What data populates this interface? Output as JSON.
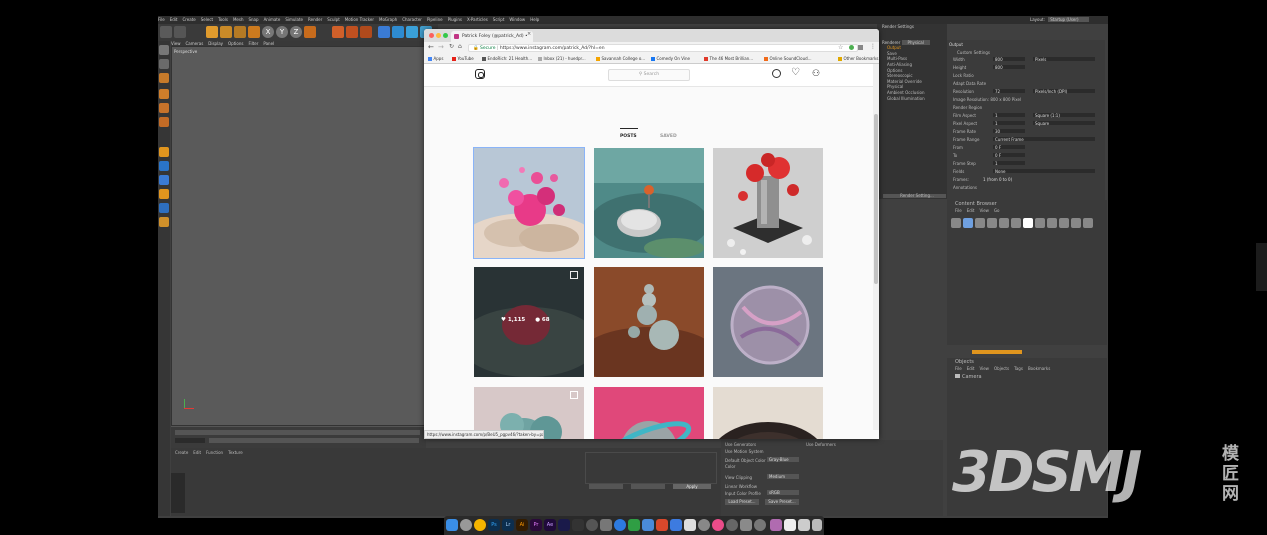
{
  "c4d": {
    "menu": [
      "File",
      "Edit",
      "Create",
      "Select",
      "Tools",
      "Mesh",
      "Snap",
      "Animate",
      "Simulate",
      "Render",
      "Sculpt",
      "Motion Tracker",
      "MoGraph",
      "Character",
      "Pipeline",
      "Plugins",
      "X-Particles",
      "Script",
      "Window",
      "Help"
    ],
    "layout_label": "Layout:",
    "layout_value": "Startup (User)",
    "viewport_menu": [
      "View",
      "Cameras",
      "Display",
      "Options",
      "Filter",
      "Panel"
    ],
    "viewport_name": "Perspective",
    "material_menu": [
      "Create",
      "Edit",
      "Function",
      "Texture"
    ],
    "apply_label": "Apply",
    "render_settings_title": "Render Settings",
    "renderer_label": "Renderer",
    "renderer_value": "Physical",
    "settings_list": [
      "Output",
      "Save",
      "Multi-Pass",
      "Anti-Aliasing",
      "Options",
      "Stereoscopic",
      "Material Override",
      "Physical",
      "Ambient Occlusion",
      "Global Illumination"
    ],
    "render_setting_btn": "Render Setting...",
    "output_title": "Output",
    "custom_settings": "Custom Settings",
    "output_rows": [
      {
        "label": "Width",
        "value": "800",
        "unit": "Pixels"
      },
      {
        "label": "Height",
        "value": "800",
        "unit": ""
      },
      {
        "label": "Lock Ratio",
        "value": "",
        "unit": ""
      },
      {
        "label": "Adapt Data Rate",
        "value": "",
        "unit": ""
      },
      {
        "label": "Resolution",
        "value": "72",
        "unit": "Pixels/Inch (DPI)"
      },
      {
        "label": "Image Resolution: 800 x 800 Pixel",
        "value": "",
        "unit": ""
      },
      {
        "label": "Render Region",
        "value": "",
        "unit": ""
      },
      {
        "label": "Film Aspect",
        "value": "1",
        "unit": "Square (1:1)"
      },
      {
        "label": "Pixel Aspect",
        "value": "1",
        "unit": "Square"
      },
      {
        "label": "Frame Rate",
        "value": "30",
        "unit": ""
      },
      {
        "label": "Frame Range",
        "value": "Current Frame",
        "unit": ""
      },
      {
        "label": "From",
        "value": "0 F",
        "unit": ""
      },
      {
        "label": "To",
        "value": "0 F",
        "unit": ""
      },
      {
        "label": "Frame Step",
        "value": "1",
        "unit": ""
      },
      {
        "label": "Fields",
        "value": "None",
        "unit": ""
      },
      {
        "label": "Frames:",
        "value": "1 (from 0 to 0)",
        "unit": ""
      },
      {
        "label": "Annotations",
        "value": "",
        "unit": ""
      }
    ],
    "content_browser_title": "Content Browser",
    "content_menu": [
      "File",
      "Edit",
      "View",
      "Go"
    ],
    "objects_title": "Objects",
    "objects_menu": [
      "File",
      "Edit",
      "View",
      "Objects",
      "Tags",
      "Bookmarks"
    ],
    "objects_item": "Camera",
    "attr_rows": [
      "Use Generators",
      "Use Motion System",
      "Default Object Color",
      "Color",
      "View Clipping",
      "Linear Workflow",
      "Input Color Profile"
    ],
    "attr_values": [
      "Gray-Blue",
      "Medium",
      "sRGB"
    ],
    "load_preset": "Load Preset...",
    "save_preset": "Save Preset...",
    "use_deformers": "Use Deformers",
    "user_name": "Patrick"
  },
  "browser": {
    "tab_title": "Patrick Foley (@patrick_Ad) •",
    "secure_label": "Secure",
    "url": "https://www.instagram.com/patrick_Ad/?hl=en",
    "bookmarks": [
      "Apps",
      "YouTube",
      "EndoRich: 21 Health...",
      "Inbox (21) - huedpr...",
      "Savannah College o...",
      "Comedy On Vine",
      "The 46 Most Brillian...",
      "Online SoundCloud...",
      "Other Bookmarks"
    ],
    "search_placeholder": "Search",
    "tab_posts": "POSTS",
    "tab_saved": "SAVED",
    "hover_likes": "1,115",
    "hover_comments": "68",
    "status_url": "https://www.instagram.com/p/BeU5_pgpv46/?taken-by=patrick_Ad"
  },
  "watermark": {
    "text": "3DSMJ",
    "cn_top": "模",
    "cn_mid": "匠",
    "cn_bot": "网"
  },
  "dock_icons": [
    "finder-icon",
    "launchpad-icon",
    "chrome-icon",
    "photoshop-icon",
    "lightroom-icon",
    "illustrator-icon",
    "premiere-icon",
    "after-effects-icon",
    "media-encoder-icon",
    "cinema4d-icon"
  ]
}
